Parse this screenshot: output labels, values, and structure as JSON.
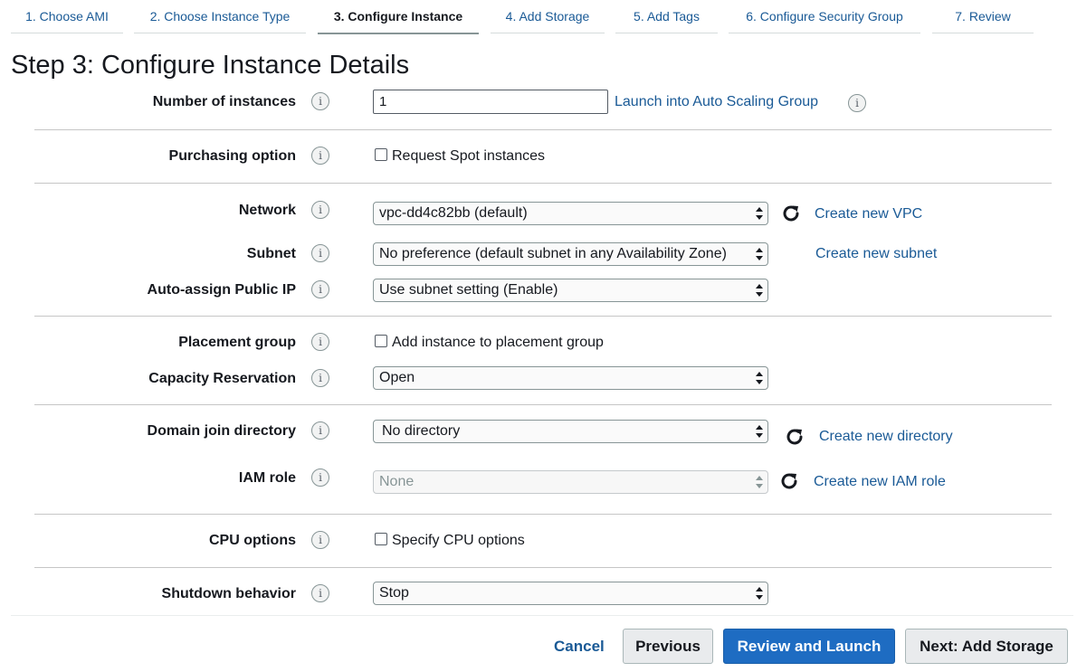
{
  "wizard": {
    "steps": [
      {
        "label": "1. Choose AMI"
      },
      {
        "label": "2. Choose Instance Type"
      },
      {
        "label": "3. Configure Instance"
      },
      {
        "label": "4. Add Storage"
      },
      {
        "label": "5. Add Tags"
      },
      {
        "label": "6. Configure Security Group"
      },
      {
        "label": "7. Review"
      }
    ],
    "active_step": 3
  },
  "page": {
    "title": "Step 3: Configure Instance Details"
  },
  "info_icon_glyph": "i",
  "form": {
    "number_of_instances": {
      "label": "Number of instances",
      "value": "1",
      "link": "Launch into Auto Scaling Group"
    },
    "purchasing_option": {
      "label": "Purchasing option",
      "checkbox_label": "Request Spot instances",
      "checked": false
    },
    "network": {
      "label": "Network",
      "selected": "vpc-dd4c82bb (default)",
      "link": "Create new VPC"
    },
    "subnet": {
      "label": "Subnet",
      "selected": "No preference (default subnet in any Availability Zone)",
      "link": "Create new subnet"
    },
    "auto_assign_public_ip": {
      "label": "Auto-assign Public IP",
      "selected": "Use subnet setting (Enable)"
    },
    "placement_group": {
      "label": "Placement group",
      "checkbox_label": "Add instance to placement group",
      "checked": false
    },
    "capacity_reservation": {
      "label": "Capacity Reservation",
      "selected": "Open"
    },
    "domain_join_directory": {
      "label": "Domain join directory",
      "selected": "No directory",
      "link": "Create new directory"
    },
    "iam_role": {
      "label": "IAM role",
      "selected": "None",
      "link": "Create new IAM role",
      "disabled": true
    },
    "cpu_options": {
      "label": "CPU options",
      "checkbox_label": "Specify CPU options",
      "checked": false
    },
    "shutdown_behavior": {
      "label": "Shutdown behavior",
      "selected": "Stop"
    }
  },
  "footer": {
    "cancel": "Cancel",
    "previous": "Previous",
    "review_and_launch": "Review and Launch",
    "next": "Next: Add Storage"
  },
  "colors": {
    "link": "#1a5a96",
    "primary_button": "#1e6cc2",
    "text": "#16191f",
    "divider": "#c6c6c6"
  }
}
